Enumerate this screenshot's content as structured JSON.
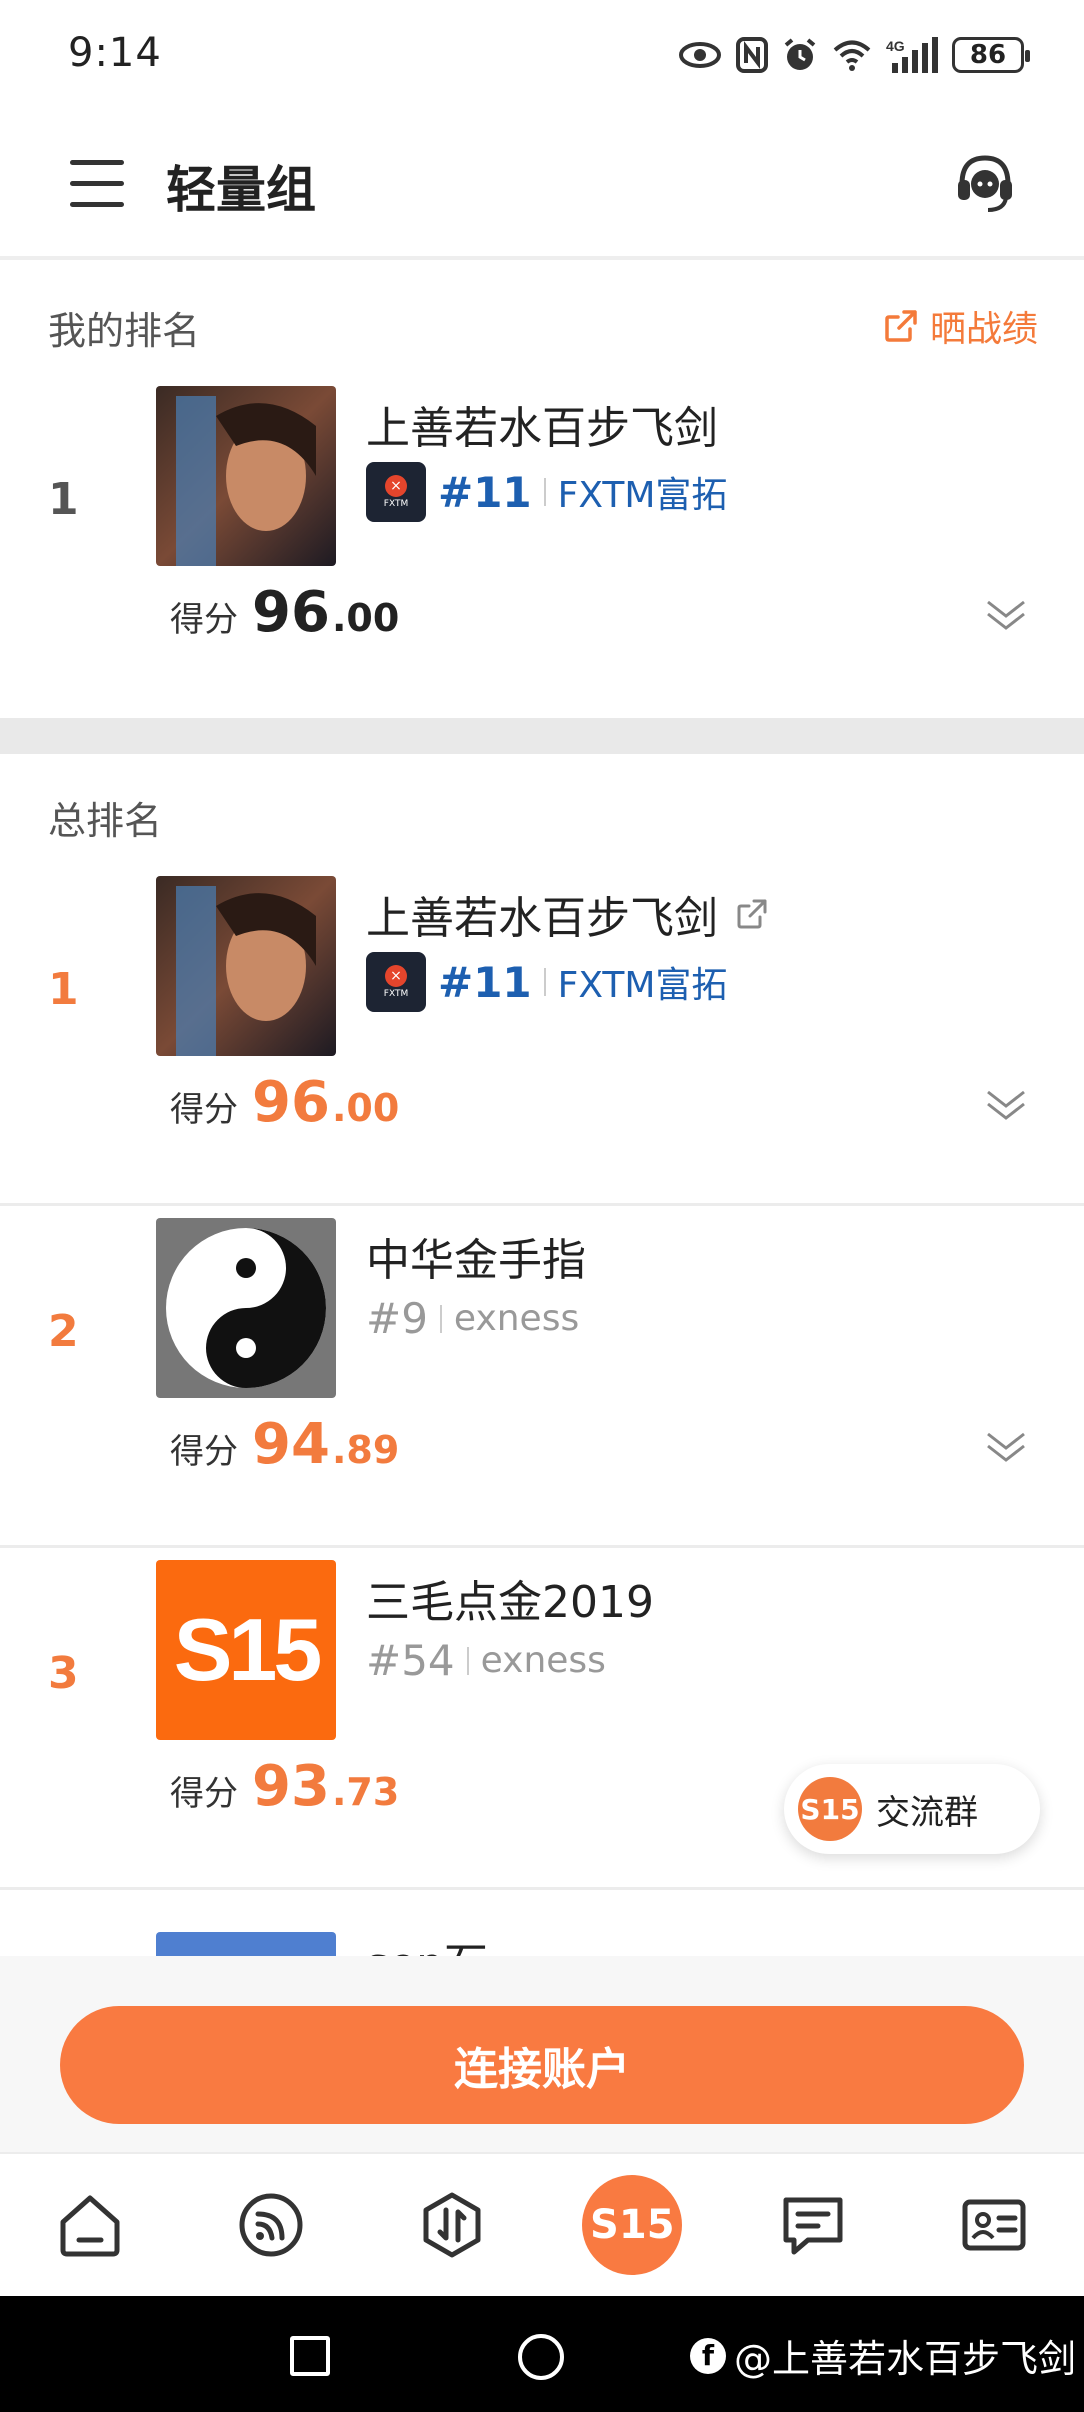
{
  "status_bar": {
    "time": "9:14",
    "network": "4G",
    "battery": "86",
    "icons": [
      "eye-icon",
      "nfc-icon",
      "alarm-icon",
      "wifi-icon",
      "signal-icon",
      "battery-icon"
    ]
  },
  "header": {
    "title": "轻量组",
    "menu_icon": "hamburger-menu-icon",
    "support_icon": "headset-icon"
  },
  "my_rank": {
    "section_title": "我的排名",
    "share_label": "晒战绩",
    "entry": {
      "rank": "1",
      "name": "上善若水百步飞剑",
      "broker_rank": "#11",
      "broker": "FXTM富拓",
      "score_label": "得分",
      "score_int": "96",
      "score_dec": ".00"
    }
  },
  "total_rank": {
    "section_title": "总排名",
    "entries": [
      {
        "rank": "1",
        "name": "上善若水百步飞剑",
        "broker_rank": "#11",
        "broker": "FXTM富拓",
        "score_label": "得分",
        "score_int": "96",
        "score_dec": ".00"
      },
      {
        "rank": "2",
        "name": "中华金手指",
        "broker_rank": "#9",
        "broker": "exness",
        "score_label": "得分",
        "score_int": "94",
        "score_dec": ".89"
      },
      {
        "rank": "3",
        "name": "三毛点金2019",
        "broker_rank": "#54",
        "broker": "exness",
        "score_label": "得分",
        "score_int": "93",
        "score_dec": ".73"
      }
    ],
    "partial_name": "sen石"
  },
  "chat_float": {
    "logo": "S15",
    "label": "交流群"
  },
  "connect_button": "连接账户",
  "tab_bar": {
    "center_logo": "S15",
    "tabs": [
      "home-icon",
      "feed-icon",
      "trade-icon",
      "s15-logo",
      "message-icon",
      "profile-card-icon"
    ]
  },
  "watermark": "@上善若水百步飞剑",
  "colors": {
    "accent": "#f97a41",
    "rank_orange": "#f27b3e",
    "broker_blue": "#1d5fb0"
  }
}
